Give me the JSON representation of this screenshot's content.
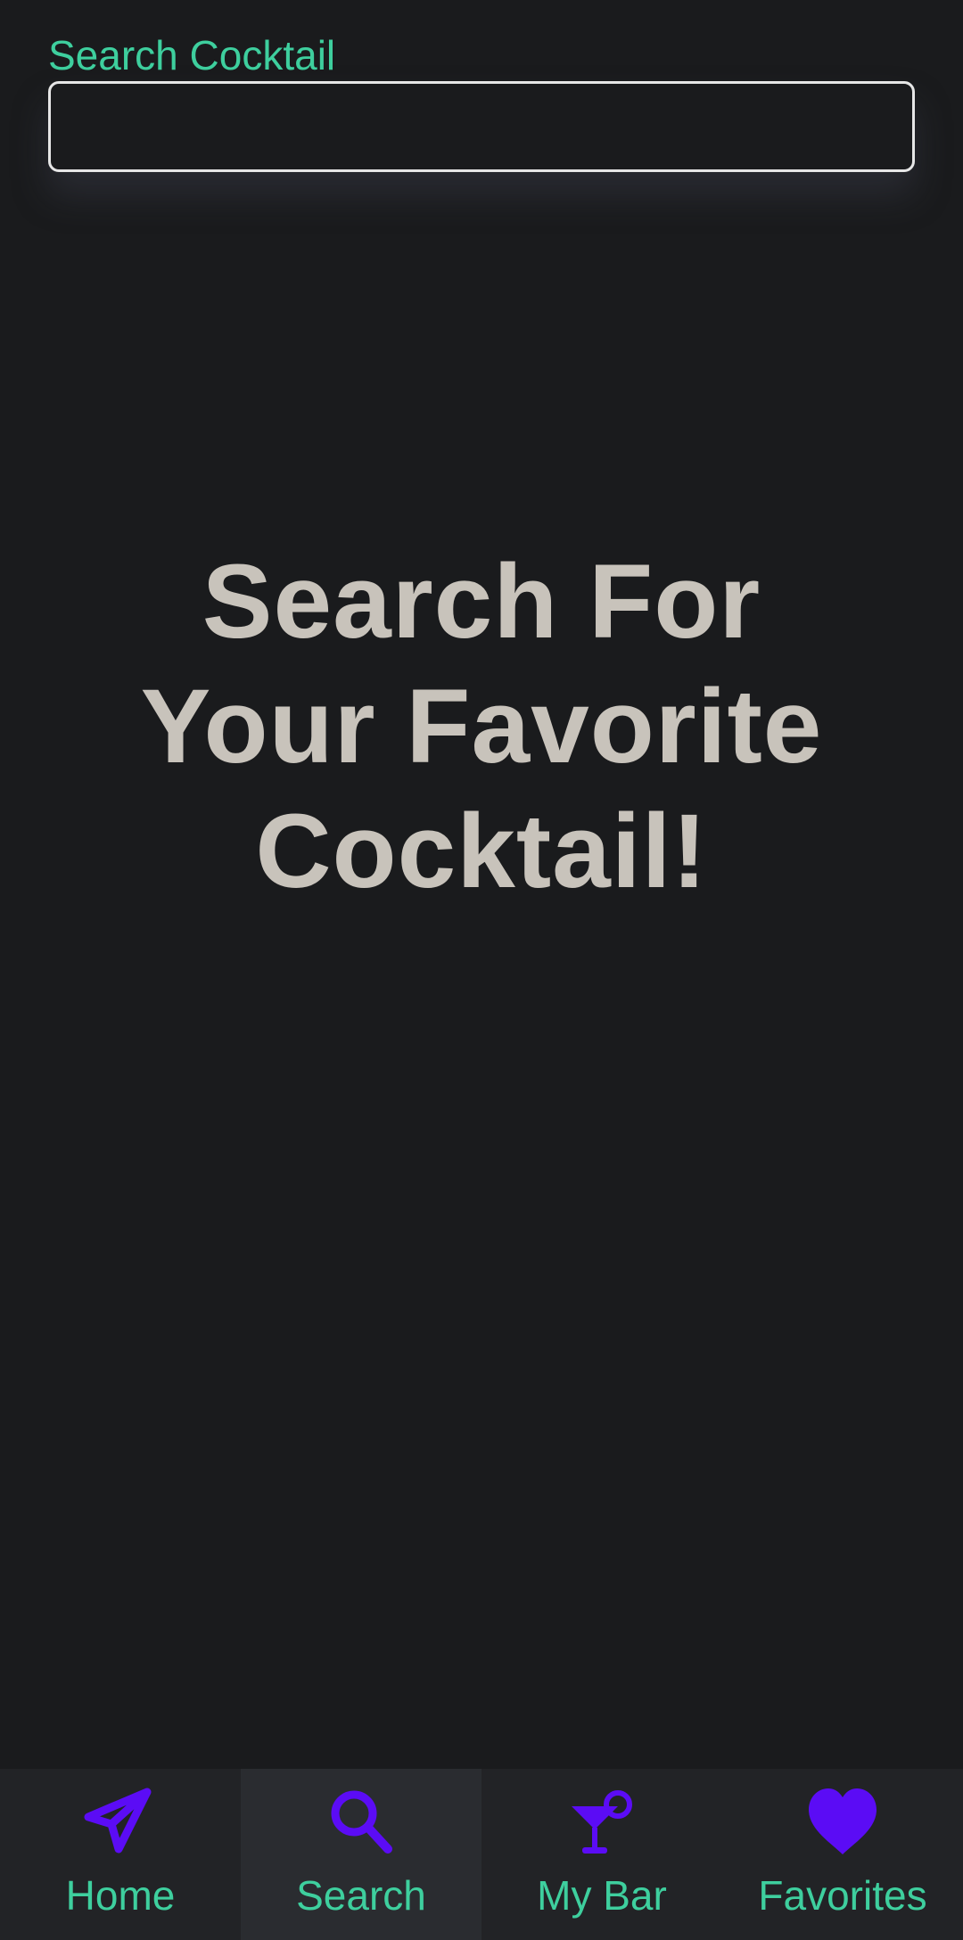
{
  "search": {
    "label": "Search Cocktail",
    "value": "",
    "placeholder": ""
  },
  "main": {
    "headline_lines": [
      "Search For",
      "Your Favorite",
      "Cocktail!"
    ]
  },
  "bottom_nav": {
    "items": [
      {
        "label": "Home",
        "icon": "paper-plane-icon",
        "active": false
      },
      {
        "label": "Search",
        "icon": "search-icon",
        "active": true
      },
      {
        "label": "My Bar",
        "icon": "cocktail-icon",
        "active": false
      },
      {
        "label": "Favorites",
        "icon": "heart-icon",
        "active": false
      }
    ]
  },
  "colors": {
    "background": "#1a1b1d",
    "accent_text": "#3ecf9e",
    "icon_color": "#5b0cf5",
    "headline": "#c8c3bb",
    "nav_background": "#222326",
    "nav_active_background": "#2a2c30"
  }
}
